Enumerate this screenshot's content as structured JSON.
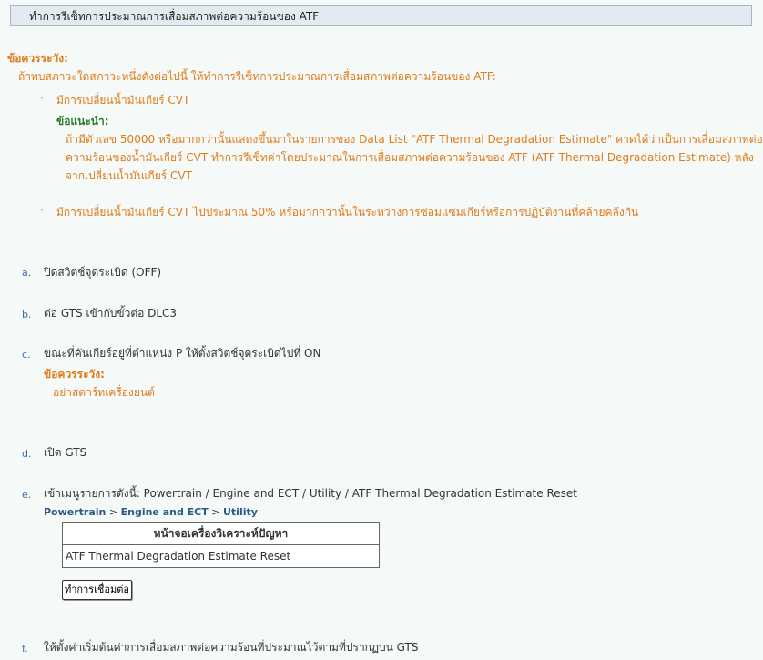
{
  "title": "ทำการรีเซ็ทการประมาณการเสื่อมสภาพต่อความร้อนของ ATF",
  "caution1": {
    "heading": "ข้อควรระวัง:",
    "intro": "ถ้าพบสภาวะใดสภาวะหนึ่งดังต่อไปนี้ ให้ทำการรีเซ็ทการประมาณการเสื่อมสภาพต่อความร้อนของ ATF:",
    "bullet1": "มีการเปลี่ยนน้ำมันเกียร์ CVT",
    "advice_heading": "ข้อแนะนำ:",
    "advice_lines": [
      "ถ้ามีตัวเลข 50000 หรือมากกว่านั้นแสดงขึ้นมาในรายการของ Data List \"ATF Thermal Degradation Estimate\" คาดได้ว่าเป็นการเสื่อมสภาพต่อ",
      "ความร้อนของน้ำมันเกียร์ CVT ทำการรีเซ็ทค่าโดยประมาณในการเสื่อมสภาพต่อความร้อนของ ATF (ATF Thermal Degradation Estimate) หลัง",
      "จากเปลี่ยนน้ำมันเกียร์ CVT"
    ],
    "bullet2": "มีการเปลี่ยนน้ำมันเกียร์ CVT ไปประมาณ 50% หรือมากกว่านั้นในระหว่างการซ่อมแซมเกียร์หรือการปฏิบัติงานที่คล้ายคลึงกัน"
  },
  "steps": {
    "a": {
      "letter": "a.",
      "text": "ปิดสวิตช์จุดระเบิด (OFF)"
    },
    "b": {
      "letter": "b.",
      "text": "ต่อ GTS เข้ากับขั้วต่อ DLC3"
    },
    "c": {
      "letter": "c.",
      "text": "ขณะที่คันเกียร์อยู่ที่ตำแหน่ง P ให้ตั้งสวิตช์จุดระเบิดไปที่ ON",
      "caution_heading": "ข้อควรระวัง:",
      "caution_text": "อย่าสตาร์ทเครื่องยนต์"
    },
    "d": {
      "letter": "d.",
      "text": "เปิด GTS"
    },
    "e": {
      "letter": "e.",
      "text": "เข้าเมนูรายการดังนี้: Powertrain / Engine and ECT / Utility / ATF Thermal Degradation Estimate Reset"
    },
    "f": {
      "letter": "f.",
      "text": "ให้ตั้งค่าเริ่มต้นค่าการเสื่อมสภาพต่อความร้อนที่ประมาณไว้ตามที่ปรากฏบน GTS"
    }
  },
  "breadcrumb": {
    "item1": "Powertrain",
    "sep": ">",
    "item2": "Engine and ECT",
    "item3": "Utility"
  },
  "diag_table": {
    "header": "หน้าจอเครื่องวิเคราะห์ปัญหา",
    "row1": "ATF Thermal Degradation Estimate Reset"
  },
  "connect_button": "ทำการเชื่อมต่อ"
}
